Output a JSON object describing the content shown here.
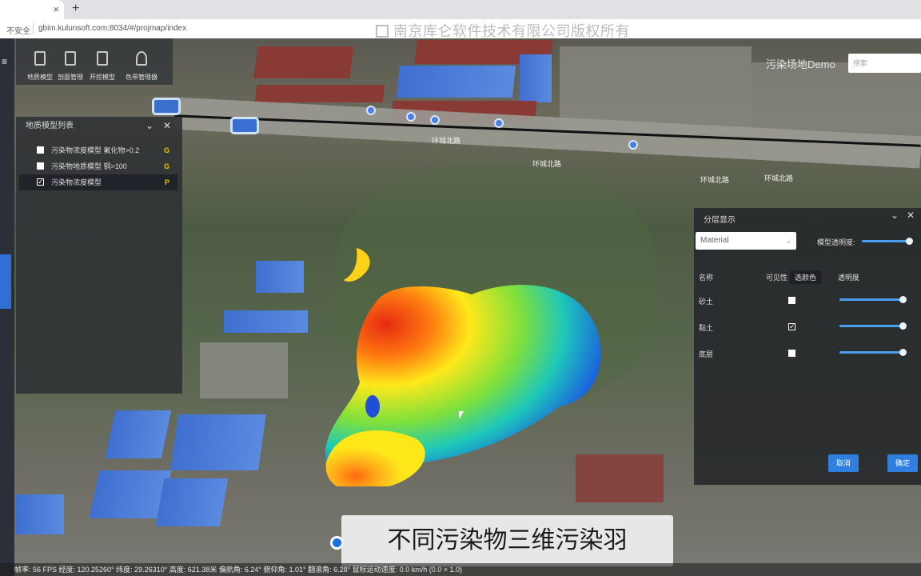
{
  "browser": {
    "tab_close": "×",
    "new_tab": "+",
    "security": "不安全",
    "url": "gbim.kulunsoft.com:8034/#/projmap/index",
    "star": "☆"
  },
  "watermark": "南京库仑软件技术有限公司版权所有",
  "toolbar": {
    "tools": [
      {
        "label": "地质模型"
      },
      {
        "label": "剖面管理"
      },
      {
        "label": "开挖模型"
      },
      {
        "label": "色带管理器"
      }
    ]
  },
  "model_list": {
    "title": "地质模型列表",
    "items": [
      {
        "label": "污染物浓度模型 氟化物>0.2",
        "tag": "G",
        "checked": false
      },
      {
        "label": "污染物地质模型 铜>100",
        "tag": "G",
        "checked": false
      },
      {
        "label": "污染物浓度模型",
        "tag": "P",
        "checked": true
      }
    ]
  },
  "header": {
    "title": "污染场地Demo",
    "search_placeholder": "搜索"
  },
  "layer_panel": {
    "title": "分层显示",
    "material_select": "Material",
    "opacity_label": "模型透明度:",
    "columns": {
      "name": "名称",
      "visible": "可见性",
      "color": "选颜色",
      "opacity": "透明度"
    },
    "rows": [
      {
        "name": "砂土",
        "visible": false,
        "opacity": 1.0
      },
      {
        "name": "黏土",
        "visible": true,
        "opacity": 1.0
      },
      {
        "name": "底层",
        "visible": false,
        "opacity": 1.0
      }
    ],
    "cancel": "取消",
    "confirm": "确定"
  },
  "map_labels": {
    "road1": "环城北路",
    "road2": "环城北路",
    "road3": "环城北路",
    "road4": "环城北路"
  },
  "subtitle": "不同污染物三维污染羽",
  "status": "帧率: 56 FPS 经度: 120.25260° 纬度: 29.26310° 高度: 621.38米 偏航角: 6.24° 俯仰角: 1.01° 翻滚角: 6.28° 鼠标运动速度: 0.0 km/h (0.0 × 1.0)"
}
